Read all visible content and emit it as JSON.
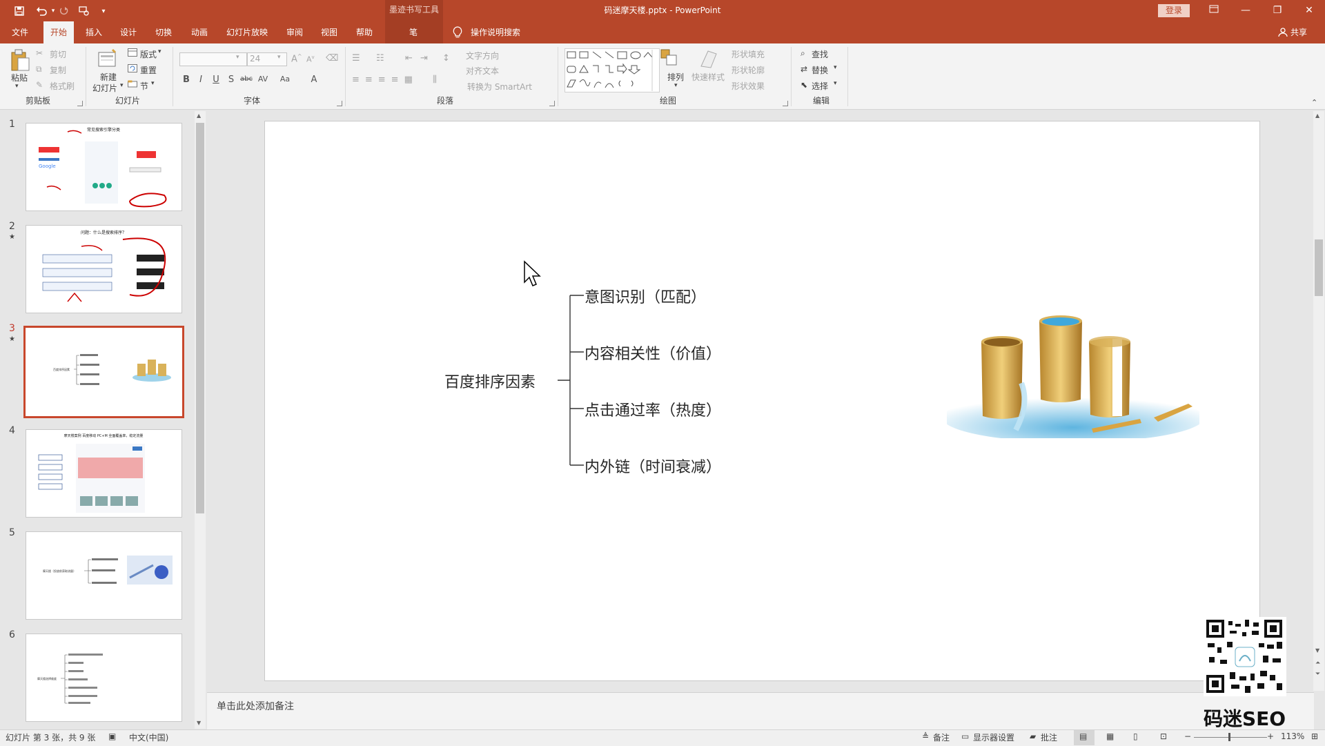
{
  "titlebar": {
    "ink_tools_context": "墨迹书写工具",
    "document_title": "码迷摩天楼.pptx  -  PowerPoint",
    "login_label": "登录"
  },
  "tabs": {
    "file": "文件",
    "home": "开始",
    "insert": "插入",
    "design": "设计",
    "transitions": "切换",
    "animations": "动画",
    "slideshow": "幻灯片放映",
    "review": "审阅",
    "view": "视图",
    "help": "帮助",
    "pen": "笔",
    "tell_me": "操作说明搜索",
    "share": "共享"
  },
  "ribbon": {
    "clipboard": {
      "label": "剪贴板",
      "paste": "粘贴",
      "cut": "剪切",
      "copy": "复制",
      "format_painter": "格式刷"
    },
    "slides": {
      "label": "幻灯片",
      "new_slide_line1": "新建",
      "new_slide_line2": "幻灯片",
      "layout": "版式",
      "reset": "重置",
      "section": "节"
    },
    "font": {
      "label": "字体",
      "font_size": "24"
    },
    "paragraph": {
      "label": "段落",
      "text_direction": "文字方向",
      "align_text": "对齐文本",
      "convert_smartart": "转换为 SmartArt"
    },
    "drawing": {
      "label": "绘图",
      "arrange": "排列",
      "quick_styles": "快速样式",
      "shape_fill": "形状填充",
      "shape_outline": "形状轮廓",
      "shape_effects": "形状效果"
    },
    "editing": {
      "label": "编辑",
      "find": "查找",
      "replace": "替换",
      "select": "选择"
    }
  },
  "thumbnails": [
    {
      "number": "1",
      "star": "",
      "title": "常见搜索引擎分类"
    },
    {
      "number": "2",
      "star": "★",
      "title": "问题：什么是搜索排序？"
    },
    {
      "number": "3",
      "star": "★",
      "title": "百度排序因素"
    },
    {
      "number": "4",
      "star": "",
      "title": "摩天楼案例 百度移动 PC+M 全面覆盖率，稳定流量"
    },
    {
      "number": "5",
      "star": "",
      "title": "摩天楼（投放前获取流量）"
    },
    {
      "number": "6",
      "star": "",
      "title": "摩天楼选择维度"
    }
  ],
  "slide": {
    "root": "百度排序因素",
    "branches": [
      "意图识别（匹配）",
      "内容相关性（价值）",
      "点击通过率（热度）",
      "内外链（时间衰减）"
    ]
  },
  "notes": {
    "placeholder": "单击此处添加备注"
  },
  "statusbar": {
    "slide_info": "幻灯片 第 3 张，共 9 张",
    "language": "中文(中国)",
    "notes": "备注",
    "display_settings": "显示器设置",
    "comments": "批注",
    "zoom": "113%"
  },
  "watermark": {
    "text": "码迷SEO"
  },
  "colors": {
    "accent": "#b7472a",
    "context_tab": "#a43e24",
    "selected_thumb_border": "#c8472c"
  }
}
